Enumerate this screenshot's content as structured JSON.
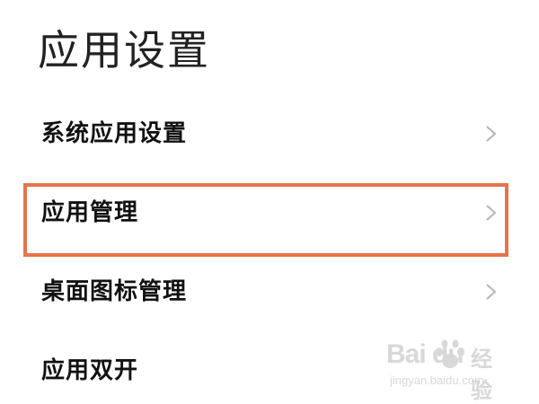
{
  "header": {
    "title": "应用设置"
  },
  "settings": {
    "items": [
      {
        "label": "系统应用设置",
        "icon": "chevron-right-icon"
      },
      {
        "label": "应用管理",
        "icon": "chevron-right-icon",
        "highlighted": true
      },
      {
        "label": "桌面图标管理",
        "icon": "chevron-right-icon"
      },
      {
        "label": "应用双开"
      }
    ]
  },
  "highlight_color": "#e8734a",
  "watermark": {
    "brand": "Bai du",
    "suffix": "经验",
    "url": "jingyan.baidu.com"
  }
}
